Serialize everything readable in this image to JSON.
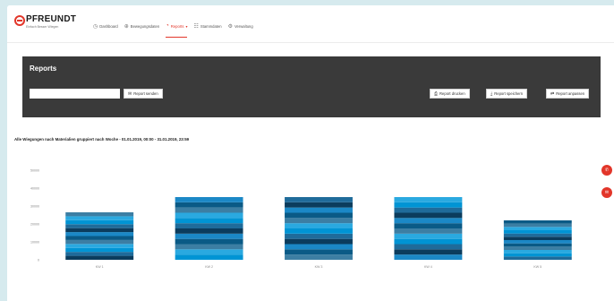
{
  "brand": {
    "name": "PFREUNDT",
    "tagline": "Einfach Besser Wiegen"
  },
  "nav": {
    "items": [
      {
        "label": "Dashboard",
        "icon": "dashboard-icon"
      },
      {
        "label": "Bewegungsdaten",
        "icon": "bewegungsdaten-icon"
      },
      {
        "label": "Reports",
        "icon": "reports-icon",
        "active": true
      },
      {
        "label": "Stammdaten",
        "icon": "stammdaten-icon"
      },
      {
        "label": "Verwaltung",
        "icon": "verwaltung-icon"
      }
    ],
    "active_color": "#e2362a"
  },
  "reports": {
    "title": "Reports",
    "input_value": "",
    "send_label": "Report senden",
    "print_label": "Report drucken",
    "save_label": "Report speichern",
    "adjust_label": "Report anpassen"
  },
  "chart_data": {
    "type": "bar",
    "stacked": true,
    "title": "Alle Wiegungen nach Materialien gruppiert nach Woche - 01.01.2019, 00:00 - 31.01.2019, 23:59",
    "categories": [
      "KW 1",
      "KW 2",
      "KW 3",
      "KW 4",
      "KW 5"
    ],
    "totals": [
      26500,
      35000,
      35000,
      35000,
      22000
    ],
    "y_ticks": [
      0,
      10000,
      20000,
      30000,
      40000,
      50000
    ],
    "ylim": [
      0,
      52000
    ],
    "grid": false,
    "segment_colors": [
      "#0b3c5d",
      "#1f6b9a",
      "#0094d4",
      "#2aa9e0",
      "#3c7ea3",
      "#0a5a86",
      "#1b88c6"
    ]
  },
  "side_actions": [
    {
      "label": "Hilfe",
      "icon": "phone-icon"
    },
    {
      "label": "Kontakt",
      "icon": "mail-icon"
    }
  ]
}
